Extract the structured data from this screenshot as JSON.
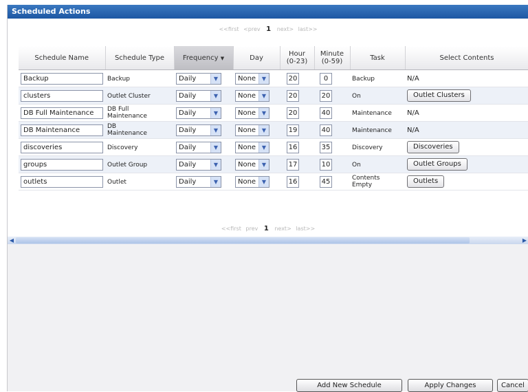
{
  "title": "Scheduled Actions",
  "pager_top": {
    "first": "<<first",
    "prev": "<prev",
    "page": "1",
    "next": "next>",
    "last": "last>>"
  },
  "pager_bottom": {
    "first": "<<first",
    "prev": "prev",
    "page": "1",
    "next": "next>",
    "last": "last>>"
  },
  "columns": {
    "schedule_name": "Schedule Name",
    "schedule_type": "Schedule Type",
    "frequency": "Frequency",
    "day": "Day",
    "hour_line1": "Hour",
    "hour_line2": "(0-23)",
    "minute_line1": "Minute",
    "minute_line2": "(0-59)",
    "task": "Task",
    "select_contents": "Select Contents"
  },
  "rows": [
    {
      "name": "Backup",
      "type1": "Backup",
      "type2": "",
      "frequency": "Daily",
      "day": "None",
      "hour": "20",
      "minute": "0",
      "task1": "Backup",
      "task2": "",
      "contents_text": "N/A",
      "contents_button": ""
    },
    {
      "name": "clusters",
      "type1": "Outlet Cluster",
      "type2": "",
      "frequency": "Daily",
      "day": "None",
      "hour": "20",
      "minute": "20",
      "task1": "On",
      "task2": "",
      "contents_text": "",
      "contents_button": "Outlet Clusters"
    },
    {
      "name": "DB Full Maintenance",
      "type1": "DB Full",
      "type2": "Maintenance",
      "frequency": "Daily",
      "day": "None",
      "hour": "20",
      "minute": "40",
      "task1": "Maintenance",
      "task2": "",
      "contents_text": "N/A",
      "contents_button": ""
    },
    {
      "name": "DB Maintenance",
      "type1": "DB",
      "type2": "Maintenance",
      "frequency": "Daily",
      "day": "None",
      "hour": "19",
      "minute": "40",
      "task1": "Maintenance",
      "task2": "",
      "contents_text": "N/A",
      "contents_button": ""
    },
    {
      "name": "discoveries",
      "type1": "Discovery",
      "type2": "",
      "frequency": "Daily",
      "day": "None",
      "hour": "16",
      "minute": "35",
      "task1": "Discovery",
      "task2": "",
      "contents_text": "",
      "contents_button": "Discoveries"
    },
    {
      "name": "groups",
      "type1": "Outlet Group",
      "type2": "",
      "frequency": "Daily",
      "day": "None",
      "hour": "17",
      "minute": "10",
      "task1": "On",
      "task2": "",
      "contents_text": "",
      "contents_button": "Outlet Groups"
    },
    {
      "name": "outlets",
      "type1": "Outlet",
      "type2": "",
      "frequency": "Daily",
      "day": "None",
      "hour": "16",
      "minute": "45",
      "task1": "Contents",
      "task2": "Empty",
      "contents_text": "",
      "contents_button": "Outlets"
    }
  ],
  "buttons": {
    "add": "Add New Schedule",
    "apply": "Apply Changes",
    "cancel": "Cancel"
  },
  "colors": {
    "title_bar": "#1d57a3",
    "alt_row": "#edf1f8",
    "sorted_header": "#c9c9ce"
  }
}
